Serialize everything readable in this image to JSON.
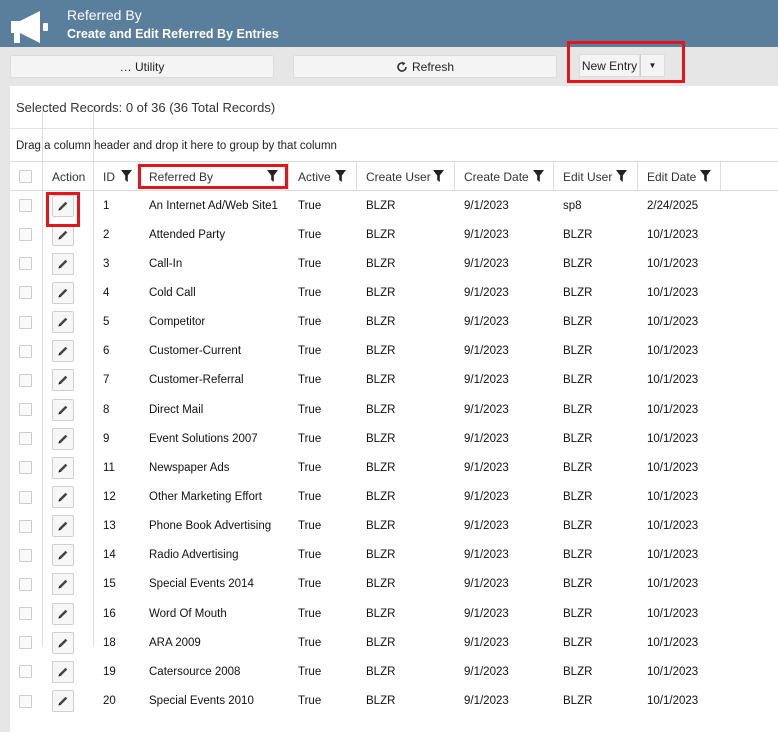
{
  "header": {
    "title": "Referred By",
    "subtitle": "Create and Edit Referred By Entries",
    "icon": "megaphone-icon",
    "background": "#5a7f9c"
  },
  "toolbar": {
    "utility_label": "… Utility",
    "refresh_label": "Refresh",
    "new_entry_label": "New Entry",
    "new_entry_dropdown": "▼"
  },
  "selected_records": "Selected Records: 0 of 36 (36 Total Records)",
  "group_hint": "Drag a column header and drop it here to group by that column",
  "columns": [
    {
      "key": "action",
      "label": "Action"
    },
    {
      "key": "id",
      "label": "ID"
    },
    {
      "key": "referred_by",
      "label": "Referred By"
    },
    {
      "key": "active",
      "label": "Active"
    },
    {
      "key": "create_user",
      "label": "Create User"
    },
    {
      "key": "create_date",
      "label": "Create Date"
    },
    {
      "key": "edit_user",
      "label": "Edit User"
    },
    {
      "key": "edit_date",
      "label": "Edit Date"
    }
  ],
  "rows": [
    {
      "id": "1",
      "referred_by": "An Internet Ad/Web Site1",
      "active": "True",
      "create_user": "BLZR",
      "create_date": "9/1/2023",
      "edit_user": "sp8",
      "edit_date": "2/24/2025"
    },
    {
      "id": "2",
      "referred_by": "Attended Party",
      "active": "True",
      "create_user": "BLZR",
      "create_date": "9/1/2023",
      "edit_user": "BLZR",
      "edit_date": "10/1/2023"
    },
    {
      "id": "3",
      "referred_by": "Call-In",
      "active": "True",
      "create_user": "BLZR",
      "create_date": "9/1/2023",
      "edit_user": "BLZR",
      "edit_date": "10/1/2023"
    },
    {
      "id": "4",
      "referred_by": "Cold Call",
      "active": "True",
      "create_user": "BLZR",
      "create_date": "9/1/2023",
      "edit_user": "BLZR",
      "edit_date": "10/1/2023"
    },
    {
      "id": "5",
      "referred_by": "Competitor",
      "active": "True",
      "create_user": "BLZR",
      "create_date": "9/1/2023",
      "edit_user": "BLZR",
      "edit_date": "10/1/2023"
    },
    {
      "id": "6",
      "referred_by": "Customer-Current",
      "active": "True",
      "create_user": "BLZR",
      "create_date": "9/1/2023",
      "edit_user": "BLZR",
      "edit_date": "10/1/2023"
    },
    {
      "id": "7",
      "referred_by": "Customer-Referral",
      "active": "True",
      "create_user": "BLZR",
      "create_date": "9/1/2023",
      "edit_user": "BLZR",
      "edit_date": "10/1/2023"
    },
    {
      "id": "8",
      "referred_by": "Direct Mail",
      "active": "True",
      "create_user": "BLZR",
      "create_date": "9/1/2023",
      "edit_user": "BLZR",
      "edit_date": "10/1/2023"
    },
    {
      "id": "9",
      "referred_by": "Event Solutions 2007",
      "active": "True",
      "create_user": "BLZR",
      "create_date": "9/1/2023",
      "edit_user": "BLZR",
      "edit_date": "10/1/2023"
    },
    {
      "id": "11",
      "referred_by": "Newspaper Ads",
      "active": "True",
      "create_user": "BLZR",
      "create_date": "9/1/2023",
      "edit_user": "BLZR",
      "edit_date": "10/1/2023"
    },
    {
      "id": "12",
      "referred_by": "Other Marketing Effort",
      "active": "True",
      "create_user": "BLZR",
      "create_date": "9/1/2023",
      "edit_user": "BLZR",
      "edit_date": "10/1/2023"
    },
    {
      "id": "13",
      "referred_by": "Phone Book Advertising",
      "active": "True",
      "create_user": "BLZR",
      "create_date": "9/1/2023",
      "edit_user": "BLZR",
      "edit_date": "10/1/2023"
    },
    {
      "id": "14",
      "referred_by": "Radio Advertising",
      "active": "True",
      "create_user": "BLZR",
      "create_date": "9/1/2023",
      "edit_user": "BLZR",
      "edit_date": "10/1/2023"
    },
    {
      "id": "15",
      "referred_by": "Special Events 2014",
      "active": "True",
      "create_user": "BLZR",
      "create_date": "9/1/2023",
      "edit_user": "BLZR",
      "edit_date": "10/1/2023"
    },
    {
      "id": "16",
      "referred_by": "Word Of Mouth",
      "active": "True",
      "create_user": "BLZR",
      "create_date": "9/1/2023",
      "edit_user": "BLZR",
      "edit_date": "10/1/2023"
    },
    {
      "id": "18",
      "referred_by": "ARA 2009",
      "active": "True",
      "create_user": "BLZR",
      "create_date": "9/1/2023",
      "edit_user": "BLZR",
      "edit_date": "10/1/2023"
    },
    {
      "id": "19",
      "referred_by": "Catersource 2008",
      "active": "True",
      "create_user": "BLZR",
      "create_date": "9/1/2023",
      "edit_user": "BLZR",
      "edit_date": "10/1/2023"
    },
    {
      "id": "20",
      "referred_by": "Special Events 2010",
      "active": "True",
      "create_user": "BLZR",
      "create_date": "9/1/2023",
      "edit_user": "BLZR",
      "edit_date": "10/1/2023"
    }
  ],
  "highlight_color": "#e3151a"
}
